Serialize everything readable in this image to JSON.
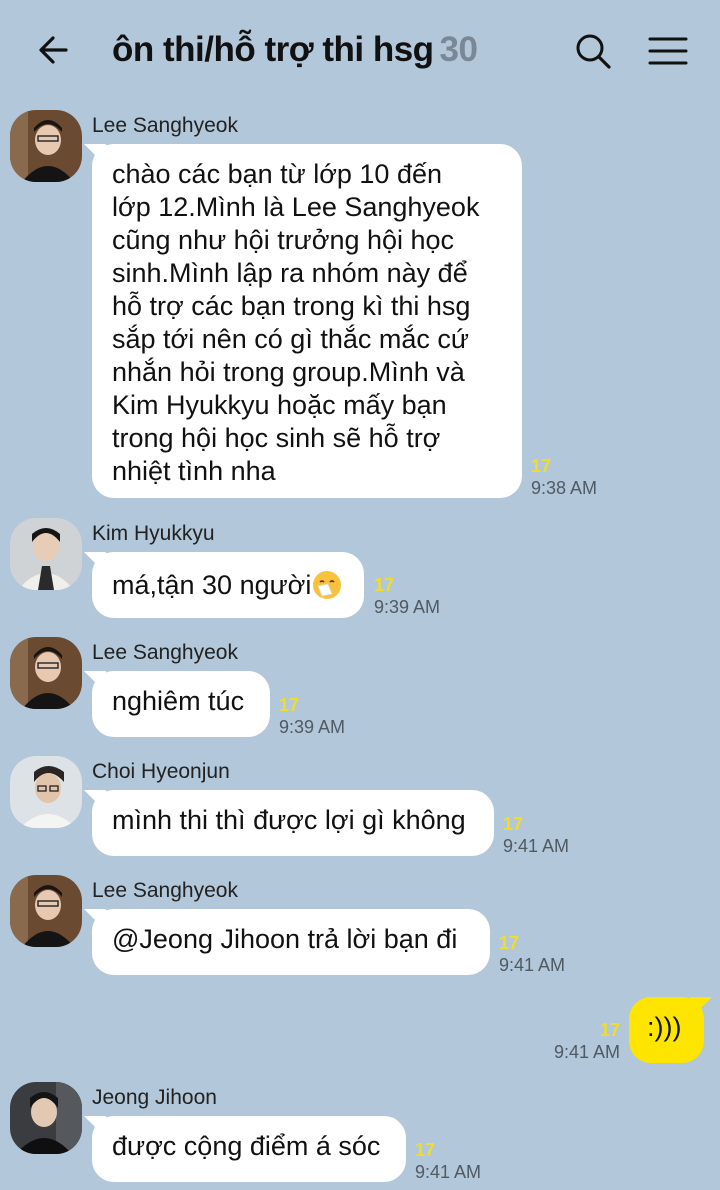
{
  "header": {
    "title": "ôn thi/hỗ trợ thi hsg",
    "member_count": "30"
  },
  "messages": [
    {
      "sender": "Lee Sanghyeok",
      "lines": [
        "chào các bạn từ lớp 10 đến",
        "lớp 12.Mình là Lee Sanghyeok",
        "cũng như hội trưởng hội học",
        "sinh.Mình lập ra nhóm này để",
        "hỗ trợ các bạn trong kì thi hsg",
        "sắp tới nên có gì thắc mắc cứ",
        "nhắn hỏi trong group.Mình và",
        "Kim Hyukkyu hoặc mấy bạn",
        "trong hội học sinh sẽ hỗ trợ",
        "nhiệt tình nha"
      ],
      "unread": "17",
      "time": "9:38 AM"
    },
    {
      "sender": "Kim Hyukkyu",
      "text": "má,tận 30 người",
      "emoji": "sneezing-face",
      "unread": "17",
      "time": "9:39 AM"
    },
    {
      "sender": "Lee Sanghyeok",
      "text": "nghiêm túc",
      "unread": "17",
      "time": "9:39 AM"
    },
    {
      "sender": "Choi Hyeonjun",
      "text": "mình thi thì được lợi gì không",
      "unread": "17",
      "time": "9:41 AM"
    },
    {
      "sender": "Lee Sanghyeok",
      "text": "@Jeong Jihoon trả lời bạn đi",
      "unread": "17",
      "time": "9:41 AM"
    },
    {
      "sender": "me",
      "text": ":)))",
      "unread": "17",
      "time": "9:41 AM"
    },
    {
      "sender": "Jeong Jihoon",
      "text": "được cộng điểm á sóc",
      "unread": "17",
      "time": "9:41 AM"
    }
  ],
  "icons": {
    "back": "arrow-left-icon",
    "search": "search-icon",
    "menu": "hamburger-menu-icon"
  },
  "colors": {
    "background": "#b2c7d9",
    "bubble_other": "#ffffff",
    "bubble_me": "#fee500",
    "unread": "#f2dc2a"
  }
}
